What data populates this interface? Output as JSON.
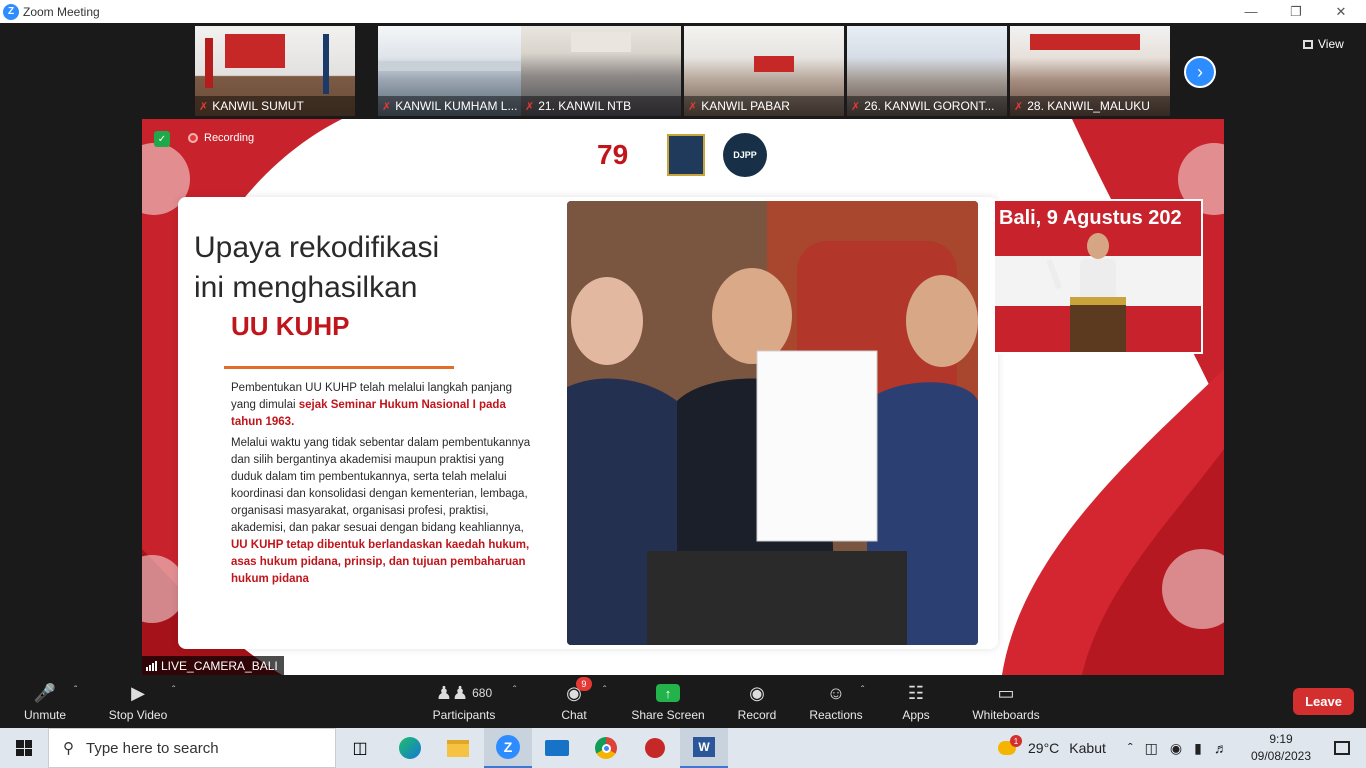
{
  "window": {
    "title": "Zoom Meeting"
  },
  "gallery": {
    "thumbnails": [
      {
        "name": "KANWIL SUMUT"
      },
      {
        "name": "KANWIL KUMHAM L..."
      },
      {
        "name": "21. KANWIL NTB"
      },
      {
        "name": "KANWIL PABAR"
      },
      {
        "name": "26. KANWIL GORONT..."
      },
      {
        "name": "28. KANWIL_MALUKU"
      }
    ],
    "view_label": "View"
  },
  "main": {
    "recording_label": "Recording",
    "slide": {
      "title_line1": "Upaya rekodifikasi",
      "title_line2": "ini menghasilkan",
      "title_red": "UU KUHP",
      "para1_a": "Pembentukan UU KUHP telah melalui langkah panjang yang dimulai ",
      "para1_b": "sejak Seminar Hukum Nasional I pada tahun 1963.",
      "para2_a": "Melalui waktu yang tidak sebentar dalam pembentukannya dan silih bergantinya akademisi maupun praktisi yang duduk dalam tim pembentukannya, serta telah melalui koordinasi dan konsolidasi dengan kementerian, lembaga, organisasi masyarakat, organisasi profesi, praktisi, akademisi, dan pakar sesuai dengan bidang keahliannya, ",
      "para2_b": "UU KUHP tetap dibentuk berlandaskan kaedah hukum, asas hukum pidana, prinsip, dan tujuan pembaharuan hukum pidana"
    },
    "logo_djpp": "DJPP",
    "inset_title": "Bali, 9 Agustus 202",
    "camera_label": "LIVE_CAMERA_BALI"
  },
  "toolbar": {
    "unmute": "Unmute",
    "stop_video": "Stop Video",
    "participants": "Participants",
    "participants_count": "680",
    "chat": "Chat",
    "chat_badge": "9",
    "share_screen": "Share Screen",
    "record": "Record",
    "reactions": "Reactions",
    "apps": "Apps",
    "whiteboards": "Whiteboards",
    "leave": "Leave"
  },
  "taskbar": {
    "search_placeholder": "Type here to search",
    "weather_temp": "29°C",
    "weather_text": "Kabut",
    "weather_badge": "1",
    "time": "9:19",
    "date": "09/08/2023"
  },
  "colors": {
    "zoom_blue": "#2D8CFF",
    "leave_red": "#d32f2f",
    "slide_red": "#c0151b",
    "share_green": "#22b34a"
  }
}
